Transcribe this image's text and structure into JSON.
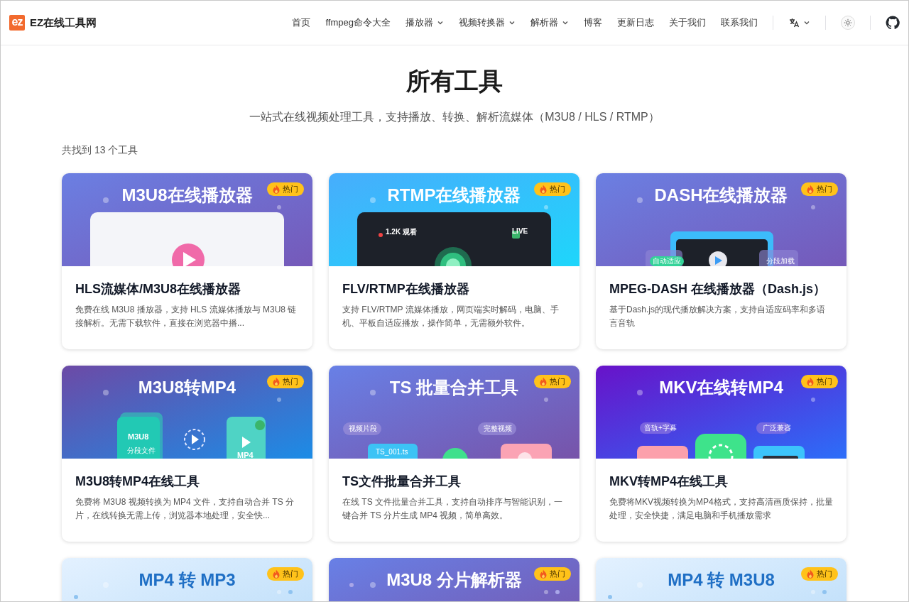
{
  "header": {
    "logo": {
      "mark": "ez",
      "name": "EZ在线工具网"
    },
    "nav": [
      {
        "label": "首页",
        "has_menu": false
      },
      {
        "label": "ffmpeg命令大全",
        "has_menu": false
      },
      {
        "label": "播放器",
        "has_menu": true
      },
      {
        "label": "视频转换器",
        "has_menu": true
      },
      {
        "label": "解析器",
        "has_menu": true
      },
      {
        "label": "博客",
        "has_menu": false
      },
      {
        "label": "更新日志",
        "has_menu": false
      },
      {
        "label": "关于我们",
        "has_menu": false
      },
      {
        "label": "联系我们",
        "has_menu": false
      }
    ]
  },
  "page": {
    "title": "所有工具",
    "subtitle": "一站式在线视频处理工具，支持播放、转换、解析流媒体（M3U8 / HLS / RTMP）",
    "count": "共找到 13 个工具"
  },
  "tools": [
    {
      "banner": {
        "kind": "player",
        "title": "M3U8在线播放器"
      },
      "badge": "热门",
      "title": "HLS流媒体/M3U8在线播放器",
      "description": "免费在线 M3U8 播放器，支持 HLS 流媒体播放与 M3U8 链接解析。无需下载软件，直接在浏览器中播..."
    },
    {
      "banner": {
        "kind": "live",
        "title": "RTMP在线播放器",
        "labels": [
          "1.2K 观看",
          "LIVE"
        ]
      },
      "badge": "热门",
      "title": "FLV/RTMP在线播放器",
      "description": "支持 FLV/RTMP 流媒体播放，网页端实时解码，电脑、手机、平板自适应播放，操作简单，无需额外软件。"
    },
    {
      "banner": {
        "kind": "dash",
        "title": "DASH在线播放器",
        "labels": [
          "自动适应",
          "分段加载"
        ]
      },
      "badge": "热门",
      "title": "MPEG-DASH 在线播放器（Dash.js）",
      "description": "基于Dash.js的现代播放解决方案，支持自适应码率和多语言音轨"
    },
    {
      "banner": {
        "kind": "convert",
        "title": "M3U8转MP4",
        "labels": [
          "M3U8",
          "分段文件",
          "MP4"
        ]
      },
      "badge": "热门",
      "title": "M3U8转MP4在线工具",
      "description": "免费将 M3U8 视频转换为 MP4 文件，支持自动合并 TS 分片，在线转换无需上传，浏览器本地处理，安全快..."
    },
    {
      "banner": {
        "kind": "merge",
        "title": "TS 批量合并工具",
        "labels": [
          "视频片段",
          "TS_001.ts",
          "完整视频"
        ]
      },
      "badge": "热门",
      "title": "TS文件批量合并工具",
      "description": "在线 TS 文件批量合并工具，支持自动排序与智能识别，一键合并 TS 分片生成 MP4 视频，简单高效。"
    },
    {
      "banner": {
        "kind": "mkv",
        "title": "MKV在线转MP4",
        "labels": [
          "音轨+字幕",
          "广泛兼容"
        ]
      },
      "badge": "热门",
      "title": "MKV转MP4在线工具",
      "description": "免费将MKV视频转换为MP4格式，支持高清画质保持，批量处理，安全快捷，满足电脑和手机播放需求"
    },
    {
      "banner": {
        "kind": "light",
        "title": "MP4 转 MP3"
      },
      "badge": "热门"
    },
    {
      "banner": {
        "kind": "parser",
        "title": "M3U8 分片解析器"
      },
      "badge": "热门"
    },
    {
      "banner": {
        "kind": "light",
        "title": "MP4 转 M3U8"
      },
      "badge": "热门"
    }
  ]
}
